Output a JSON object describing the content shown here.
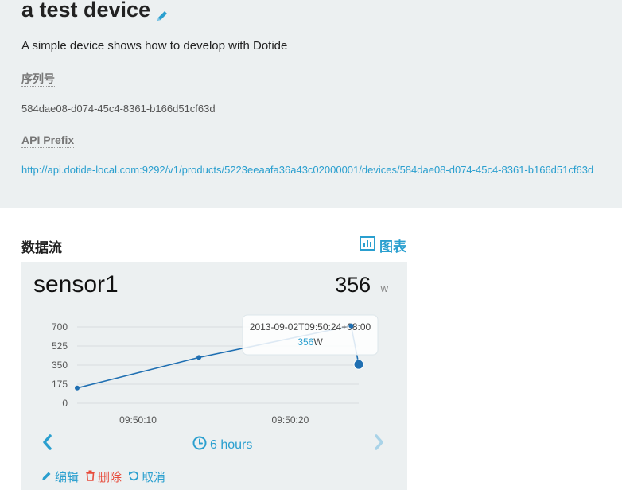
{
  "device": {
    "title": "a test device",
    "description": "A simple device shows how to develop with Dotide",
    "serial_label": "序列号",
    "serial_value": "584dae08-d074-45c4-8361-b166d51cf63d",
    "api_label": "API Prefix",
    "api_value": "http://api.dotide-local.com:9292/v1/products/5223eeaafa36a43c02000001/devices/584dae08-d074-45c4-8361-b166d51cf63d"
  },
  "datastreams": {
    "heading": "数据流",
    "chart_link_label": "图表"
  },
  "sensor": {
    "name": "sensor1",
    "value": "356",
    "unit": "w",
    "time_range_label": "6 hours",
    "actions": {
      "edit": "编辑",
      "delete": "删除",
      "cancel": "取消"
    }
  },
  "tooltip": {
    "time": "2013-09-02T09:50:24+08:00",
    "value": "356",
    "unit": "W"
  },
  "colors": {
    "accent": "#2a9fcf",
    "danger": "#e74c3c",
    "panel_bg": "#ecf0f1",
    "series": "#1f6fb2"
  },
  "chart_data": {
    "type": "line",
    "series": [
      {
        "values": [
          {
            "x": "09:50:06",
            "y": 140
          },
          {
            "x": "09:50:14",
            "y": 420
          },
          {
            "x": "09:50:24",
            "y": 710
          },
          {
            "x": "09:50:24.5",
            "y": 356
          }
        ]
      }
    ],
    "x_ticks": [
      "09:50:10",
      "09:50:20"
    ],
    "y_ticks": [
      "0",
      "175",
      "350",
      "525",
      "700"
    ],
    "ylim": [
      0,
      700
    ],
    "grid": true
  }
}
